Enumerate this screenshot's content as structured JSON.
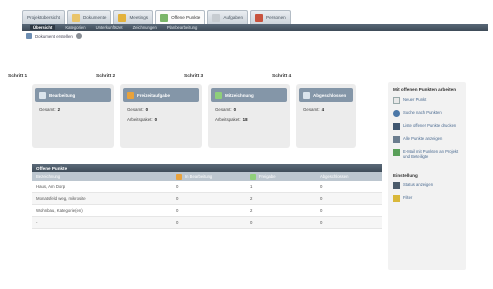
{
  "tabs": [
    {
      "label": "Projektübersicht",
      "color": "#9ab4cc"
    },
    {
      "label": "Dokumente",
      "color": "#e9c46a"
    },
    {
      "label": "Meetings",
      "color": "#e3b23c"
    },
    {
      "label": "Offene Punkte",
      "color": "#7bb66a"
    },
    {
      "label": "Aufgaben",
      "color": "#c7ccd1"
    },
    {
      "label": "Personen",
      "color": "#c8533e"
    }
  ],
  "subnav": [
    "Übersicht",
    "Kategorien",
    "Unterkunftszet",
    "Zeichnungen",
    "Planbearbeitung"
  ],
  "toolbar": {
    "label": "Dokument erstellen"
  },
  "stages": [
    {
      "label": "Schritt 1",
      "title": "Bearbeitung",
      "rows": [
        {
          "k": "Gesamt:",
          "v": "2"
        }
      ]
    },
    {
      "label": "Schritt 2",
      "title": "Freizeitaufgabe",
      "rows": [
        {
          "k": "Gesamt:",
          "v": "0"
        },
        {
          "k": "Arbeitspaket:",
          "v": "0"
        }
      ]
    },
    {
      "label": "Schritt 3",
      "title": "Mitzeichnung",
      "rows": [
        {
          "k": "Gesamt:",
          "v": "0"
        },
        {
          "k": "Arbeitspaket:",
          "v": "18"
        }
      ]
    },
    {
      "label": "Schritt 4",
      "title": "Abgeschlossen",
      "rows": [
        {
          "k": "Gesamt:",
          "v": "4"
        }
      ]
    }
  ],
  "table": {
    "title": "Offene Punkte",
    "headers": [
      "Bezeichnung",
      "In Bearbeitung",
      "Freigabe",
      "Abgeschlossen"
    ],
    "rows": [
      [
        "Haus, Am Dorp",
        "0",
        "1",
        "0"
      ],
      [
        "Monatsfeld weg, mikrosite",
        "0",
        "2",
        "0"
      ],
      [
        "Wohnbau, Kategorie(en)",
        "0",
        "2",
        "0"
      ],
      [
        "-",
        "0",
        "0",
        "0"
      ]
    ]
  },
  "panel": {
    "title": "Mit offenen Punkten arbeiten",
    "items": [
      {
        "label": "Neuer Punkt",
        "icon": "new-doc-icon"
      },
      {
        "label": "Suche nach Punkten",
        "icon": "search-icon"
      },
      {
        "label": "Liste offener Punkte drucken",
        "icon": "print-icon"
      },
      {
        "label": "Alle Punkte anzeigen",
        "icon": "list-icon"
      },
      {
        "label": "E-Mail mit Punkten an Projekt und Beteiligte",
        "icon": "mail-icon"
      }
    ],
    "section2": "Einstellung",
    "items2": [
      {
        "label": "Status anzeigen",
        "icon": "status-icon"
      },
      {
        "label": "Filter",
        "icon": "filter-icon"
      }
    ]
  }
}
